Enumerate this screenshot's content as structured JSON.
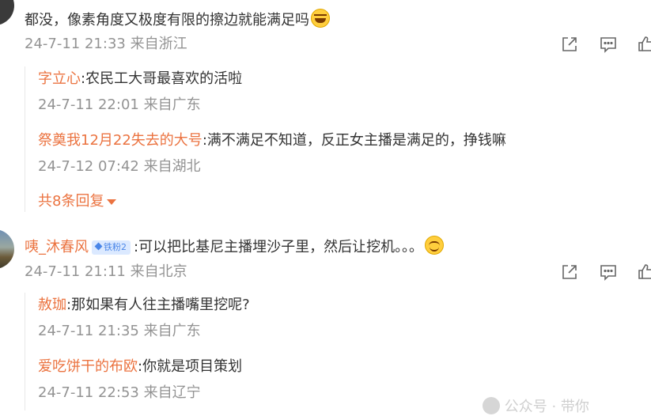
{
  "comment1": {
    "text": "都没，像素角度又极度有限的擦边就能满足吗",
    "emoji": "laughing-tears-emoji",
    "meta": "24-7-11 21:33 来自浙江",
    "replies": [
      {
        "user": "字立心",
        "text": ":农民工大哥最喜欢的活啦",
        "meta": "24-7-11 22:01 来自广东"
      },
      {
        "user": "祭奠我12月22失去的大号",
        "text": ":满不满足不知道，反正女主播是满足的，挣钱嘛",
        "meta": "24-7-12 07:42 来自湖北"
      }
    ],
    "more_replies": "共8条回复"
  },
  "comment2": {
    "user": "咦_沐春风",
    "badge": "铁粉2",
    "text": ":可以把比基尼主播埋沙子里，然后让挖机。。。",
    "emoji": "smile-emoji",
    "meta": "24-7-11 21:11 来自北京",
    "replies": [
      {
        "user": "赦珈",
        "text": ":那如果有人往主播嘴里挖呢?",
        "meta": "24-7-11 21:35 来自广东"
      },
      {
        "user": "爱吃饼干的布欧",
        "text": ":你就是项目策划",
        "meta": "24-7-11 22:53 来自辽宁"
      }
    ]
  },
  "action_icons": [
    "share-icon",
    "comment-icon",
    "like-icon"
  ],
  "footer_watermark": "公众号 · 带你",
  "colors": {
    "username": "#eb7340",
    "meta": "#939393",
    "text": "#333333"
  }
}
